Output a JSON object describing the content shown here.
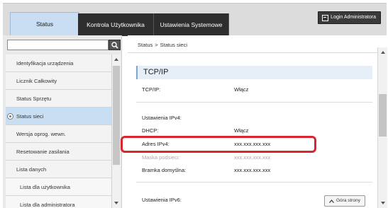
{
  "tabs": [
    {
      "label": "Status",
      "active": true
    },
    {
      "label": "Kontrola Użytkownika",
      "active": false
    },
    {
      "label": "Ustawienia Systemowe",
      "active": false
    }
  ],
  "login_button": {
    "label": "Login Administratora",
    "icon": "login-icon"
  },
  "search": {
    "value": "",
    "placeholder": ""
  },
  "menu": {
    "items": [
      {
        "label": "Identyfikacja urządzenia"
      },
      {
        "label": "Licznik Całkowity"
      },
      {
        "label": "Status Sprzętu"
      },
      {
        "label": "Status sieci",
        "active": true
      },
      {
        "label": "Wersja oprog. wewn."
      },
      {
        "label": "Resetowanie zasilania"
      },
      {
        "label": "Lista danych"
      },
      {
        "label": "Lista dla użytkownika",
        "sub": true
      },
      {
        "label": "Lista dla administratora",
        "sub": true
      }
    ]
  },
  "breadcrumb": {
    "parent": "Status",
    "separator": ">",
    "current": "Status sieci"
  },
  "main": {
    "section_title": "TCP/IP",
    "tcpip": {
      "label": "TCP/IP:",
      "value": "Włącz"
    },
    "ipv4_header": "Ustawienia IPv4:",
    "dhcp": {
      "label": "DHCP:",
      "value": "Włącz"
    },
    "ipv4_address": {
      "label": "Adres IPv4:",
      "value": "xxx.xxx.xxx.xxx"
    },
    "subnet_mask": {
      "label": "Maska podsieci:",
      "value": "xxx.xxx.xxx.xxx"
    },
    "gateway": {
      "label": "Bramka domyślna:",
      "value": "xxx.xxx.xxx.xxx"
    },
    "ipv6_header": "Ustawienia IPv6:",
    "top_button": "Góra strony"
  },
  "colors": {
    "highlight": "#d8262e",
    "active_tab": "#c9def2",
    "tab_dark": "#2e2e2e"
  }
}
